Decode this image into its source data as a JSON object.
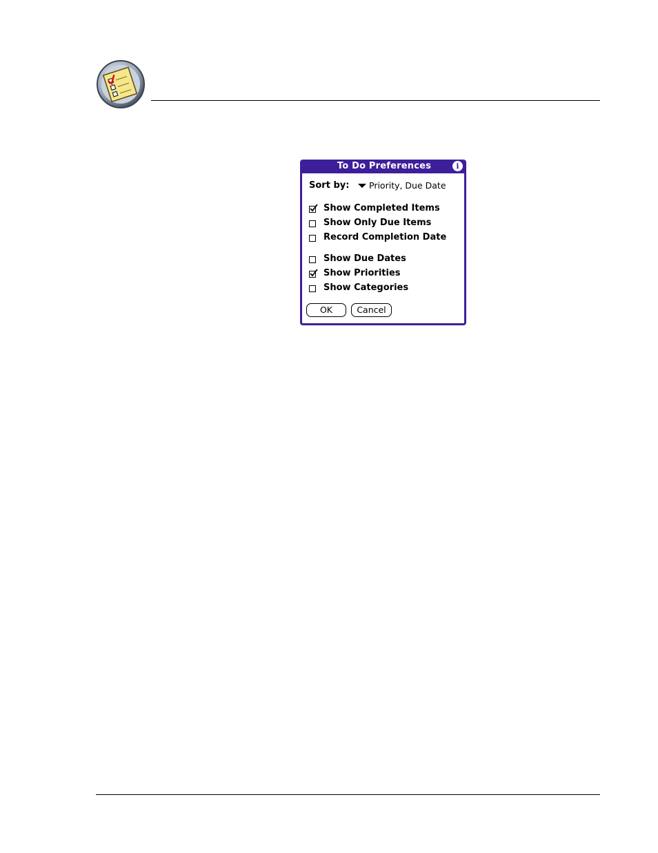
{
  "dialog": {
    "title": "To Do Preferences",
    "sort_by_label": "Sort by:",
    "sort_by_value": "Priority, Due Date",
    "options": [
      {
        "label": "Show Completed Items",
        "checked": true
      },
      {
        "label": "Show Only Due Items",
        "checked": false
      },
      {
        "label": "Record Completion Date",
        "checked": false
      },
      {
        "label": "Show Due Dates",
        "checked": false
      },
      {
        "label": "Show Priorities",
        "checked": true
      },
      {
        "label": "Show Categories",
        "checked": false
      }
    ],
    "ok_label": "OK",
    "cancel_label": "Cancel",
    "info_icon": "info-icon"
  },
  "icons": {
    "chapter": "todo-checklist-icon"
  },
  "colors": {
    "dialog_frame": "#3d1f9a"
  }
}
